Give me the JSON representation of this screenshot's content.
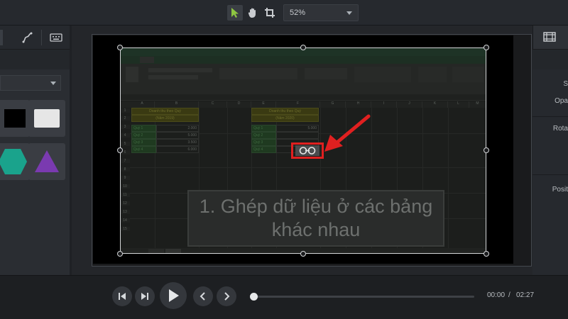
{
  "toolbar": {
    "zoom_value": "52%",
    "tools": [
      "select-arrow-icon",
      "pan-hand-icon",
      "crop-icon"
    ],
    "active_color": "#8ec641"
  },
  "left_panel": {
    "tabs": [
      "motion-path-icon",
      "keyboard-icon"
    ],
    "shapes": [
      {
        "name": "shape-black-rectangle",
        "color": "#000000"
      },
      {
        "name": "shape-white-rectangle",
        "color": "#e6e6e6"
      },
      {
        "name": "shape-teal-hexagon",
        "color": "#1aa38c"
      },
      {
        "name": "shape-purple-triangle",
        "color": "#7a3ab0"
      }
    ]
  },
  "video": {
    "caption": "1. Ghép dữ liệu ở các bảng khác nhau",
    "table_left": {
      "title_line1": "Doanh thu theo Quý",
      "title_line2": "(Năm 2019)",
      "rows": [
        {
          "label": "Quý 1",
          "value": "2.000"
        },
        {
          "label": "Quý 2",
          "value": "5.000"
        },
        {
          "label": "Quý 3",
          "value": "3.500"
        },
        {
          "label": "Quý 4",
          "value": "6.000"
        }
      ]
    },
    "table_right": {
      "title_line1": "Doanh thu theo Quý",
      "title_line2": "(Năm 2020)",
      "rows": [
        {
          "label": "Quý 1",
          "value": "5.000"
        },
        {
          "label": "Quý 2",
          "value": ""
        },
        {
          "label": "Quý 3",
          "value": ""
        },
        {
          "label": "Quý 4",
          "value": ""
        }
      ]
    },
    "columns": [
      "A",
      "B",
      "C",
      "D",
      "E",
      "F",
      "G",
      "H",
      "I",
      "J",
      "K",
      "L",
      "M"
    ],
    "rows": [
      "1",
      "2",
      "3",
      "4",
      "5",
      "6",
      "7",
      "8",
      "9",
      "10",
      "11",
      "12",
      "13",
      "14",
      "15"
    ],
    "highlight_color": "#e02020"
  },
  "right_panel": {
    "labels": [
      "S",
      "Opa",
      "Rota",
      "Posit"
    ]
  },
  "transport": {
    "current_time": "00:00",
    "separator": "/",
    "total_time": "02:27",
    "progress": 0.0
  }
}
